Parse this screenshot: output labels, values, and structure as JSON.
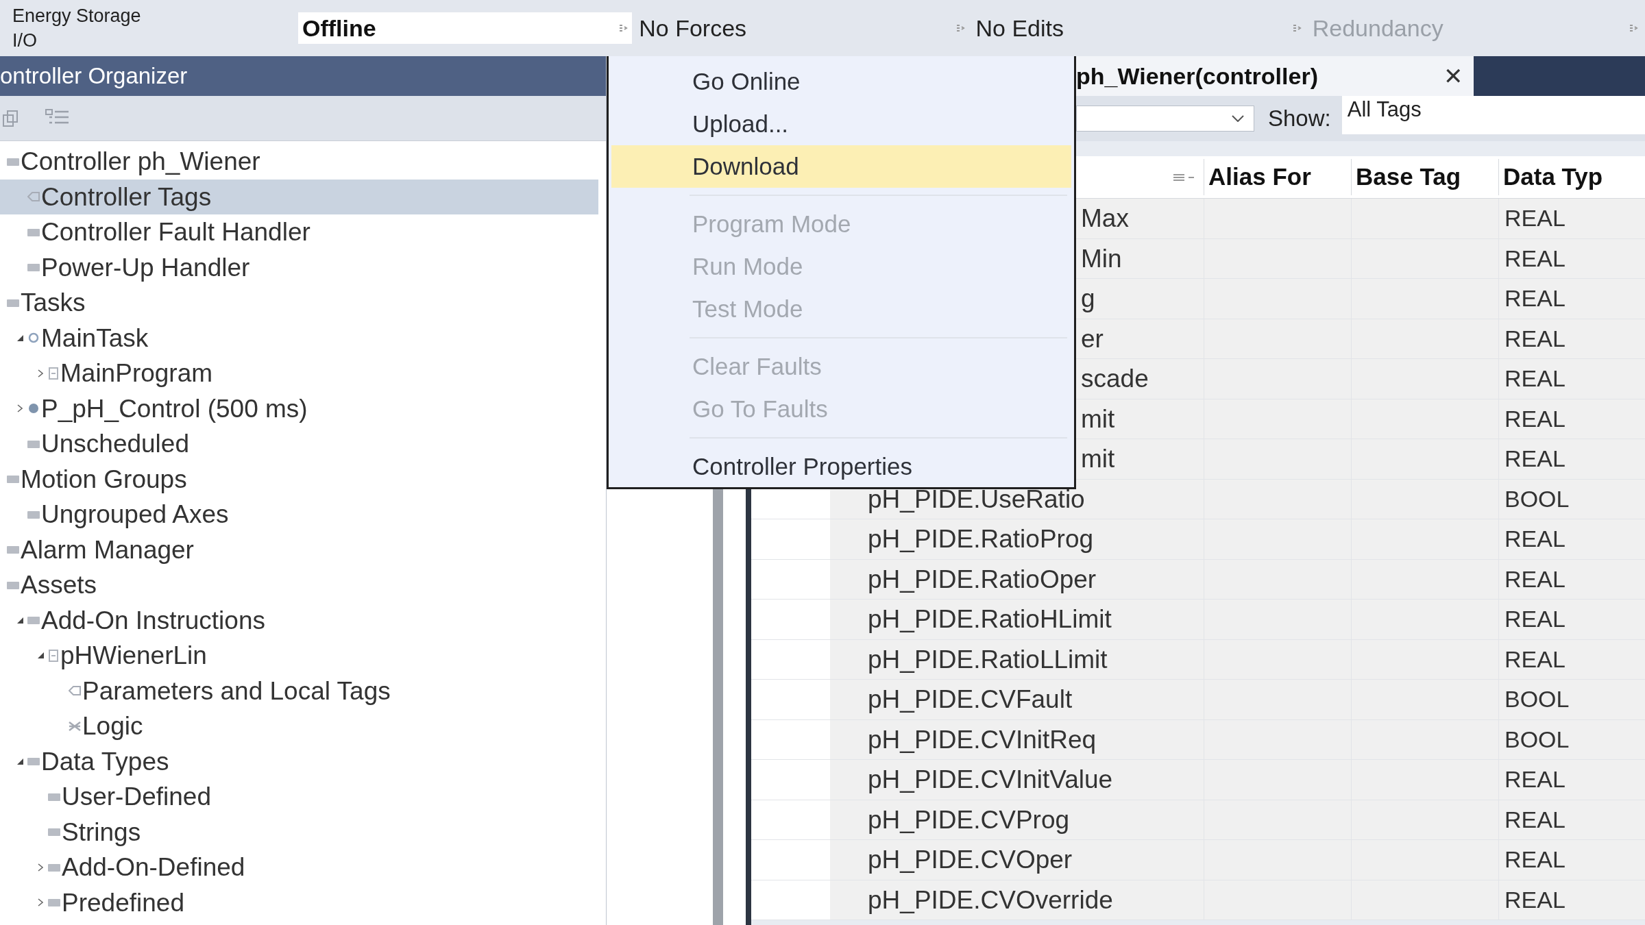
{
  "top_bar": {
    "labels": [
      "Energy Storage",
      "I/O"
    ],
    "status": [
      {
        "text": "Offline",
        "disabled": false,
        "primary": true
      },
      {
        "text": "No Forces",
        "disabled": false,
        "primary": false
      },
      {
        "text": "No Edits",
        "disabled": false,
        "primary": false
      },
      {
        "text": "Redundancy",
        "disabled": true,
        "primary": false
      }
    ]
  },
  "organizer": {
    "title": "ontroller Organizer",
    "tree": [
      {
        "label": "Controller ph_Wiener",
        "kind": "folder",
        "selected": false,
        "children": [
          {
            "label": "Controller Tags",
            "kind": "tag",
            "selected": true
          },
          {
            "label": "Controller Fault Handler",
            "kind": "folder",
            "selected": false
          },
          {
            "label": "Power-Up Handler",
            "kind": "folder",
            "selected": false
          }
        ]
      },
      {
        "label": "Tasks",
        "kind": "folder",
        "selected": false,
        "children": [
          {
            "label": "MainTask",
            "kind": "task",
            "selected": false,
            "expanded": true,
            "children": [
              {
                "label": "MainProgram",
                "kind": "program",
                "selected": false,
                "expanded": false
              }
            ]
          },
          {
            "label": "P_pH_Control (500 ms)",
            "kind": "periodic",
            "selected": false,
            "expanded": false
          },
          {
            "label": "Unscheduled",
            "kind": "folder",
            "selected": false
          }
        ]
      },
      {
        "label": "Motion Groups",
        "kind": "folder",
        "selected": false,
        "children": [
          {
            "label": "Ungrouped Axes",
            "kind": "folder",
            "selected": false
          }
        ]
      },
      {
        "label": "Alarm Manager",
        "kind": "folder",
        "selected": false
      },
      {
        "label": "Assets",
        "kind": "folder",
        "selected": false,
        "children": [
          {
            "label": "Add-On Instructions",
            "kind": "folder",
            "selected": false,
            "expanded": true,
            "children": [
              {
                "label": "pHWienerLin",
                "kind": "program",
                "selected": false,
                "expanded": true,
                "children": [
                  {
                    "label": "Parameters and Local Tags",
                    "kind": "tag",
                    "selected": false
                  },
                  {
                    "label": "Logic",
                    "kind": "logic",
                    "selected": false
                  }
                ]
              }
            ]
          },
          {
            "label": "Data Types",
            "kind": "folder",
            "selected": false,
            "expanded": true,
            "children": [
              {
                "label": "User-Defined",
                "kind": "folder",
                "selected": false
              },
              {
                "label": "Strings",
                "kind": "folder",
                "selected": false
              },
              {
                "label": "Add-On-Defined",
                "kind": "folder",
                "selected": false,
                "expanded": false
              },
              {
                "label": "Predefined",
                "kind": "folder",
                "selected": false,
                "expanded": false
              }
            ]
          }
        ]
      }
    ]
  },
  "editor": {
    "tab": {
      "title": "ph_Wiener(controller)",
      "close": "✕"
    },
    "show_label": "Show:",
    "show_value": "All Tags",
    "table": {
      "columns": [
        "Alias For",
        "Base Tag",
        "Data Typ"
      ],
      "rows": [
        {
          "name": "Max",
          "kind": "covered",
          "data_type": "REAL"
        },
        {
          "name": "Min",
          "kind": "covered",
          "data_type": "REAL"
        },
        {
          "name": "g",
          "kind": "covered",
          "data_type": "REAL"
        },
        {
          "name": "er",
          "kind": "covered",
          "data_type": "REAL"
        },
        {
          "name": "scade",
          "kind": "covered",
          "data_type": "REAL"
        },
        {
          "name": "mit",
          "kind": "covered",
          "data_type": "REAL"
        },
        {
          "name": "mit",
          "kind": "covered",
          "data_type": "REAL"
        },
        {
          "name": "pH_PIDE.UseRatio",
          "kind": "full",
          "data_type": "BOOL"
        },
        {
          "name": "pH_PIDE.RatioProg",
          "kind": "full",
          "data_type": "REAL"
        },
        {
          "name": "pH_PIDE.RatioOper",
          "kind": "full",
          "data_type": "REAL"
        },
        {
          "name": "pH_PIDE.RatioHLimit",
          "kind": "full",
          "data_type": "REAL"
        },
        {
          "name": "pH_PIDE.RatioLLimit",
          "kind": "full",
          "data_type": "REAL"
        },
        {
          "name": "pH_PIDE.CVFault",
          "kind": "full",
          "data_type": "BOOL"
        },
        {
          "name": "pH_PIDE.CVInitReq",
          "kind": "full",
          "data_type": "BOOL"
        },
        {
          "name": "pH_PIDE.CVInitValue",
          "kind": "full",
          "data_type": "REAL"
        },
        {
          "name": "pH_PIDE.CVProg",
          "kind": "full",
          "data_type": "REAL"
        },
        {
          "name": "pH_PIDE.CVOper",
          "kind": "full",
          "data_type": "REAL"
        },
        {
          "name": "pH_PIDE.CVOverride",
          "kind": "full",
          "data_type": "REAL"
        }
      ]
    }
  },
  "context_menu": [
    {
      "kind": "item",
      "label": "Go Online",
      "disabled": false,
      "selected": false
    },
    {
      "kind": "item",
      "label": "Upload...",
      "disabled": false,
      "selected": false
    },
    {
      "kind": "item",
      "label": "Download",
      "disabled": false,
      "selected": true
    },
    {
      "kind": "separator"
    },
    {
      "kind": "item",
      "label": "Program Mode",
      "disabled": true,
      "selected": false
    },
    {
      "kind": "item",
      "label": "Run Mode",
      "disabled": true,
      "selected": false
    },
    {
      "kind": "item",
      "label": "Test Mode",
      "disabled": true,
      "selected": false
    },
    {
      "kind": "separator"
    },
    {
      "kind": "item",
      "label": "Clear Faults",
      "disabled": true,
      "selected": false
    },
    {
      "kind": "item",
      "label": "Go To Faults",
      "disabled": true,
      "selected": false
    },
    {
      "kind": "separator"
    },
    {
      "kind": "item",
      "label": "Controller Properties",
      "disabled": false,
      "selected": false
    }
  ]
}
